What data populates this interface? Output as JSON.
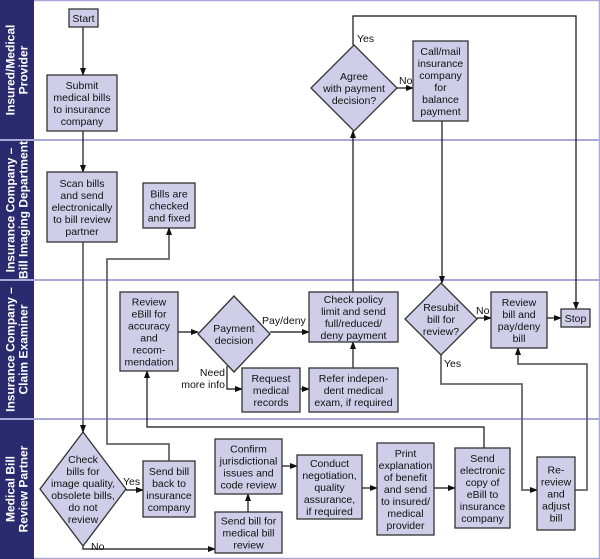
{
  "colors": {
    "lane_header": "#2a2a6e",
    "lane_divider": "#a9a8d6",
    "node_fill": "#cfcde8",
    "node_border": "#333333"
  },
  "lanes": [
    {
      "lines": [
        "Insured/Medical",
        "Provider"
      ]
    },
    {
      "lines": [
        "Insurance Company –",
        "Bill Imaging Department"
      ]
    },
    {
      "lines": [
        "Insurance Company –",
        "Claim Examiner"
      ]
    },
    {
      "lines": [
        "Medical Bill",
        "Review Partner"
      ]
    }
  ],
  "nodes": {
    "start": {
      "lines": [
        "Start"
      ]
    },
    "submit": {
      "lines": [
        "Submit",
        "medical bills",
        "to insurance",
        "company"
      ]
    },
    "scan": {
      "lines": [
        "Scan bills",
        "and send",
        "electronically",
        "to bill review",
        "partner"
      ]
    },
    "checked": {
      "lines": [
        "Bills are",
        "checked",
        "and fixed"
      ]
    },
    "review_ebill": {
      "lines": [
        "Review",
        "eBill for",
        "accuracy",
        "and",
        "recom-",
        "mendation"
      ]
    },
    "payment_decision": {
      "lines": [
        "Payment",
        "decision"
      ]
    },
    "check_policy": {
      "lines": [
        "Check policy",
        "limit and send",
        "full/reduced/",
        "deny payment"
      ]
    },
    "request_records": {
      "lines": [
        "Request",
        "medical",
        "records"
      ]
    },
    "refer_exam": {
      "lines": [
        "Refer indepen-",
        "dent medical",
        "exam, if required"
      ]
    },
    "agree": {
      "lines": [
        "Agree",
        "with payment",
        "decision?"
      ]
    },
    "call_mail": {
      "lines": [
        "Call/mail",
        "insurance",
        "company",
        "for",
        "balance",
        "payment"
      ]
    },
    "resubmit": {
      "lines": [
        "Resubit",
        "bill for",
        "review?"
      ]
    },
    "review_pay": {
      "lines": [
        "Review",
        "bill and",
        "pay/deny",
        "bill"
      ]
    },
    "stop": {
      "lines": [
        "Stop"
      ]
    },
    "check_bills": {
      "lines": [
        "Check",
        "bills for",
        "image quality,",
        "obsolete bills,",
        "do not",
        "review"
      ]
    },
    "send_back": {
      "lines": [
        "Send bill",
        "back to",
        "insurance",
        "company"
      ]
    },
    "confirm": {
      "lines": [
        "Confirm",
        "jurisdictional",
        "issues and",
        "code review"
      ]
    },
    "send_review": {
      "lines": [
        "Send bill for",
        "medical bill",
        "review"
      ]
    },
    "conduct": {
      "lines": [
        "Conduct",
        "negotiation,",
        "quality",
        "assurance,",
        "if required"
      ]
    },
    "print_eob": {
      "lines": [
        "Print",
        "explanation",
        "of benefit",
        "and send",
        "to insured/",
        "medical",
        "provider"
      ]
    },
    "send_electronic": {
      "lines": [
        "Send",
        "electronic",
        "copy of",
        "eBill to",
        "insurance",
        "company"
      ]
    },
    "rereview": {
      "lines": [
        "Re-",
        "review",
        "and",
        "adjust",
        "bill"
      ]
    }
  },
  "edge_labels": {
    "agree_yes": "Yes",
    "agree_no": "No",
    "pay_deny": "Pay/deny",
    "need_more_info": [
      "Need",
      "more info"
    ],
    "resubmit_no": "No",
    "resubmit_yes": "Yes",
    "check_yes": "Yes",
    "check_no": "No"
  }
}
